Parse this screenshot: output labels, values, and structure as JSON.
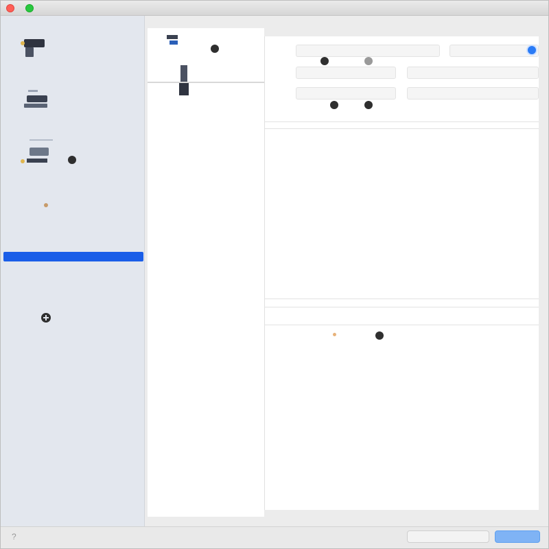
{
  "window": {
    "title": ""
  },
  "sidebar": {
    "items": [
      {
        "label": "",
        "sub": "",
        "icon": "vault-icon"
      },
      {
        "label": "",
        "sub": "",
        "icon": "tools-icon"
      },
      {
        "label": "",
        "sub": "",
        "icon": "network-icon"
      },
      {
        "label": "",
        "sub": "",
        "icon": "user-icon"
      },
      {
        "label": "",
        "sub": "",
        "icon": "folder-icon"
      },
      {
        "label": "",
        "sub": "",
        "icon": "add-icon"
      }
    ]
  },
  "list": {
    "items": [
      {
        "label": "",
        "icon": "document-icon"
      },
      {
        "label": "",
        "icon": "key-icon"
      }
    ]
  },
  "content": {
    "rows": [
      {
        "label": "",
        "value": ""
      },
      {
        "label": "",
        "value": ""
      },
      {
        "label": "",
        "value": ""
      }
    ],
    "status_text": "",
    "footer_label": "",
    "footer_value": ""
  },
  "bottom": {
    "secondary_button": "",
    "primary_button": ""
  },
  "colors": {
    "accent": "#1a5ee8",
    "radio": "#2a7bf6",
    "primary_button": "#7fb3f5"
  }
}
